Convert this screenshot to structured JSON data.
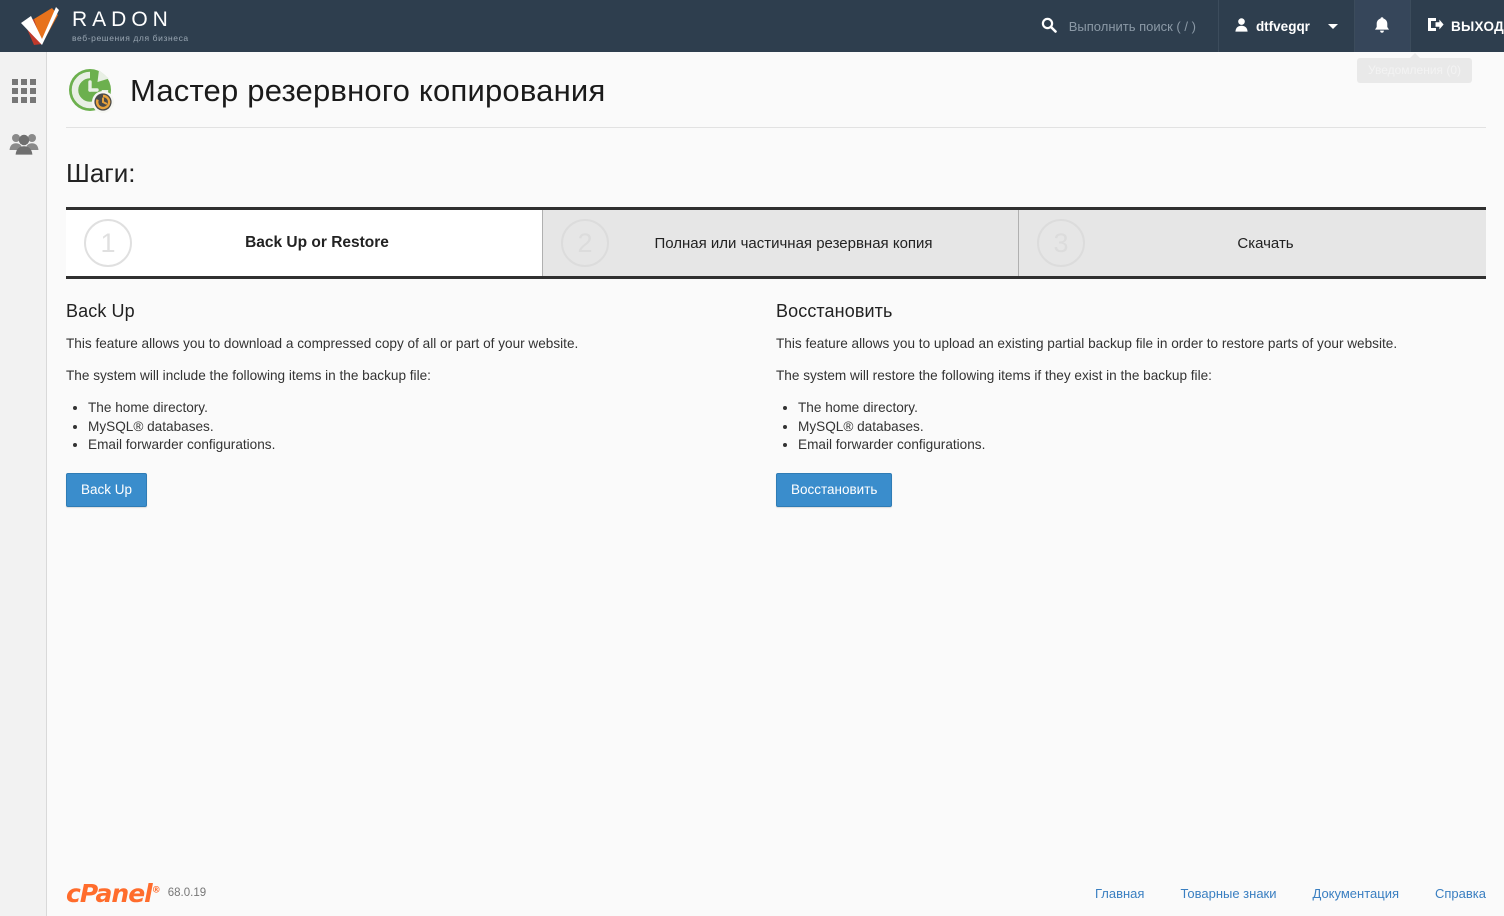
{
  "topbar": {
    "brand_name": "RADON",
    "brand_tagline": "веб-решения для бизнеса",
    "search_placeholder": "Выполнить поиск ( / )",
    "username": "dtfvegqr",
    "logout_label": "ВЫХОД",
    "notifications_tooltip": "Уведомления (0)",
    "bg_color": "#2e3e4e"
  },
  "sidebar": {
    "items": [
      {
        "name": "apps",
        "icon": "grid-icon"
      },
      {
        "name": "users",
        "icon": "users-icon"
      }
    ]
  },
  "page": {
    "title": "Мастер резервного копирования",
    "icon": "backup-wizard-icon",
    "steps_heading": "Шаги:"
  },
  "steps": [
    {
      "number": "1",
      "label": "Back Up or Restore",
      "active": true
    },
    {
      "number": "2",
      "label": "Полная или частичная резервная копия",
      "active": false
    },
    {
      "number": "3",
      "label": "Скачать",
      "active": false
    }
  ],
  "backup": {
    "heading": "Back Up",
    "intro": "This feature allows you to download a compressed copy of all or part of your website.",
    "list_intro": "The system will include the following items in the backup file:",
    "items": [
      "The home directory.",
      "MySQL® databases.",
      "Email forwarder configurations."
    ],
    "button_label": "Back Up"
  },
  "restore": {
    "heading": "Восстановить",
    "intro": "This feature allows you to upload an existing partial backup file in order to restore parts of your website.",
    "list_intro": "The system will restore the following items if they exist in the backup file:",
    "items": [
      "The home directory.",
      "MySQL® databases.",
      "Email forwarder configurations."
    ],
    "button_label": "Восстановить"
  },
  "footer": {
    "product": "cPanel",
    "version": "68.0.19",
    "links": [
      "Главная",
      "Товарные знаки",
      "Документация",
      "Справка"
    ]
  },
  "colors": {
    "accent_blue": "#3a8dcc",
    "topbar": "#2e3e4e",
    "cpanel_orange": "#ff6c2c",
    "link_blue": "#3a7fc1"
  }
}
